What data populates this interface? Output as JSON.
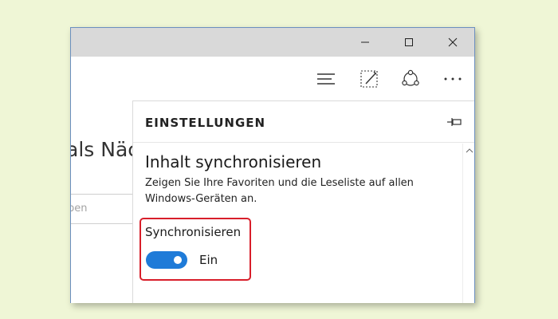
{
  "page": {
    "heading_partial": "als Näc",
    "search_placeholder_partial": "ben"
  },
  "toolbar": {
    "hub_icon": "hub-lines-icon",
    "note_icon": "web-note-icon",
    "share_icon": "share-icon",
    "more_icon": "more-dots-icon",
    "more_label": "···"
  },
  "panel": {
    "title": "EINSTELLUNGEN",
    "pin_icon": "pin-icon",
    "section_title": "Inhalt synchronisieren",
    "section_description": "Zeigen Sie Ihre Favoriten und die Leseliste auf allen Windows-Geräten an.",
    "sync_label": "Synchronisieren",
    "toggle_state": "Ein",
    "toggle_on": true
  },
  "colors": {
    "background": "#eff6d6",
    "titlebar": "#d9d9d9",
    "toggle_accent": "#1f7bd8",
    "highlight_border": "#d81e2a"
  }
}
